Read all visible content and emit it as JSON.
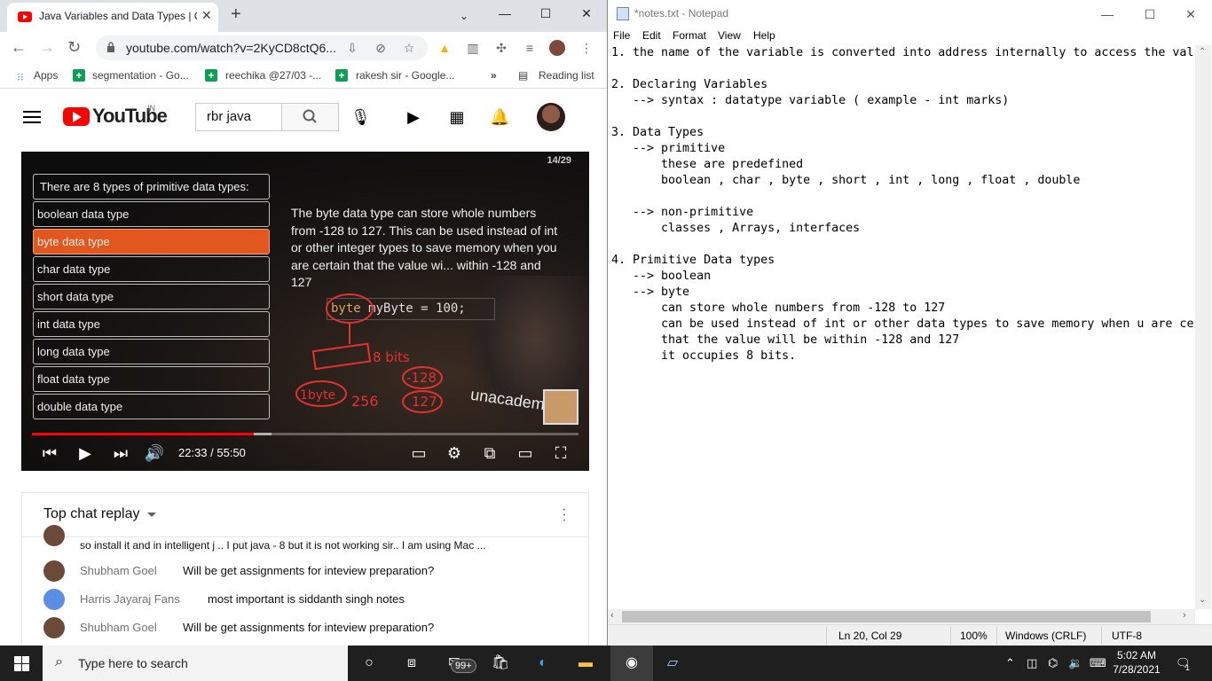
{
  "chrome": {
    "tab_title": "Java Variables and Data Types | C",
    "url": "youtube.com/watch?v=2KyCD8ctQ6...",
    "bookmarks": [
      {
        "label": "Apps"
      },
      {
        "label": "segmentation - Go..."
      },
      {
        "label": "reechika @27/03 -..."
      },
      {
        "label": "rakesh sir - Google..."
      },
      {
        "label": "Reading list"
      }
    ]
  },
  "youtube": {
    "wordmark": "YouTube",
    "region": "IN",
    "search_value": "rbr java",
    "video": {
      "slide_number": "14/29",
      "types_heading": "There are 8 types of primitive data types:",
      "types": [
        "boolean data type",
        "byte data type",
        "char data type",
        "short data type",
        "int data type",
        "long data type",
        "float data type",
        "double data type"
      ],
      "active_type_index": 1,
      "description": "The byte data type can store whole numbers from -128 to 127. This can be used instead of int or other integer types to save memory when you are certain that the value wi... within -128 and 127",
      "code_keyword": "byte",
      "code_rest": "myByte = 100;",
      "annotation_1": "8 bits",
      "annotation_2": "-128",
      "annotation_3": "127",
      "annotation_4": "1byte",
      "annotation_5": "256",
      "watermark": "unacademy",
      "time": "22:33 / 55:50",
      "progress_fraction": 0.406
    },
    "chat": {
      "title": "Top chat replay",
      "partial_line": "so install it and in intelligent j .. I put java - 8 but it is not working sir.. I am using Mac ...",
      "messages": [
        {
          "author": "Shubham Goel",
          "text": "Will be get assignments for inteview preparation?"
        },
        {
          "author": "Harris Jayaraj Fans",
          "text": "most important is siddanth singh notes"
        },
        {
          "author": "Shubham Goel",
          "text": "Will be get assignments for inteview preparation?"
        }
      ]
    }
  },
  "notepad": {
    "title": "*notes.txt - Notepad",
    "menu": [
      "File",
      "Edit",
      "Format",
      "View",
      "Help"
    ],
    "content": "1. the name of the variable is converted into address internally to access the val\n\n2. Declaring Variables\n   --> syntax : datatype variable ( example - int marks)\n\n3. Data Types\n   --> primitive\n       these are predefined\n       boolean , char , byte , short , int , long , float , double\n\n   --> non-primitive\n       classes , Arrays, interfaces\n\n4. Primitive Data types\n   --> boolean\n   --> byte\n       can store whole numbers from -128 to 127\n       can be used instead of int or other data types to save memory when u are ce\n       that the value will be within -128 and 127\n       it occupies 8 bits.",
    "status": {
      "position": "Ln 20, Col 29",
      "zoom": "100%",
      "line_ending": "Windows (CRLF)",
      "encoding": "UTF-8"
    }
  },
  "taskbar": {
    "search_placeholder": "Type here to search",
    "mail_badge": "99+",
    "time": "5:02 AM",
    "date": "7/28/2021",
    "notification_count": "1"
  }
}
